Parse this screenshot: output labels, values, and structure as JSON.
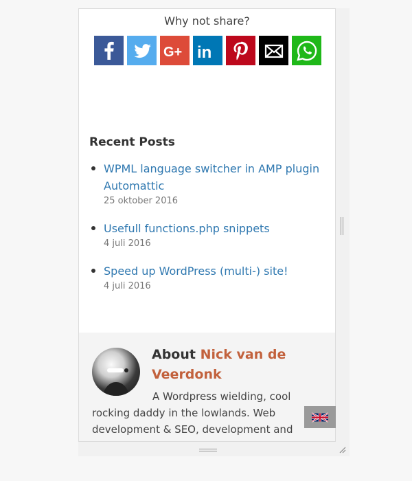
{
  "share": {
    "title": "Why not share?",
    "buttons": [
      {
        "name": "facebook",
        "icon": "facebook-icon",
        "color": "#3b5998"
      },
      {
        "name": "twitter",
        "icon": "twitter-icon",
        "color": "#55acee"
      },
      {
        "name": "google-plus",
        "icon": "google-plus-icon",
        "color": "#dd4b39"
      },
      {
        "name": "linkedin",
        "icon": "linkedin-icon",
        "color": "#0077b5"
      },
      {
        "name": "pinterest",
        "icon": "pinterest-icon",
        "color": "#bd081c"
      },
      {
        "name": "email",
        "icon": "email-icon",
        "color": "#000000"
      },
      {
        "name": "whatsapp",
        "icon": "whatsapp-icon",
        "color": "#1fb819"
      }
    ]
  },
  "recent": {
    "title": "Recent Posts",
    "posts": [
      {
        "title": "WPML language switcher in AMP plugin Automattic",
        "date": "25 oktober 2016"
      },
      {
        "title": "Usefull functions.php snippets",
        "date": "4 juli 2016"
      },
      {
        "title": "Speed up WordPress (multi-) site!",
        "date": "4 juli 2016"
      }
    ]
  },
  "about": {
    "prefix": "About",
    "name": "Nick van de Veerdonk",
    "text": "A Wordpress wielding, cool rocking daddy in the lowlands. Web development & SEO, development and"
  },
  "language": {
    "icon": "uk-flag-icon"
  },
  "colors": {
    "link": "#2f78b0",
    "accent": "#c2613c"
  }
}
